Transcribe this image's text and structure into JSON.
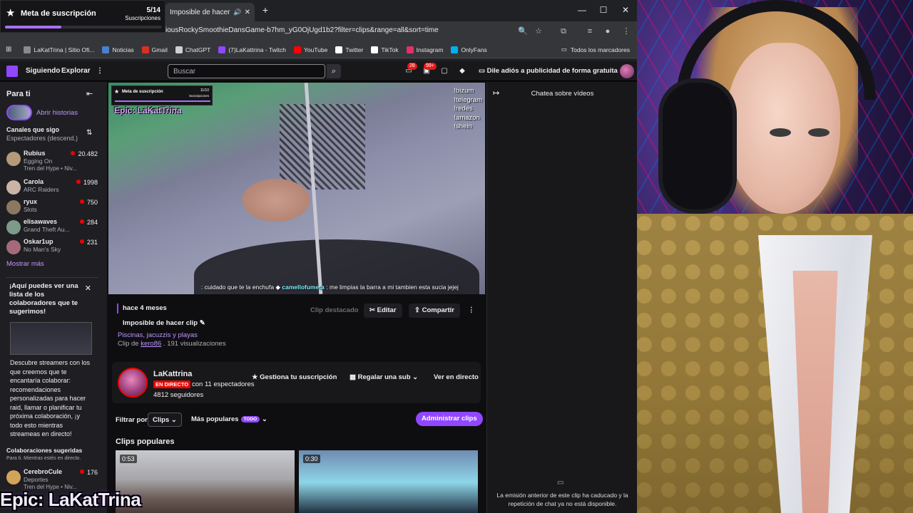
{
  "browser": {
    "tab_title": "Imposible de hacer cl",
    "url": "iousRockySmoothieDansGame-b7hm_yG0OjUgd1b2?filter=clips&range=all&sort=time",
    "bookmarks": [
      {
        "label": "LaKatTrina | Sitio Ofi...",
        "color": "#8a8a8a"
      },
      {
        "label": "Noticias",
        "color": "#4a7fd1"
      },
      {
        "label": "Gmail",
        "color": "#d93025"
      },
      {
        "label": "ChatGPT",
        "color": "#cfcfcf"
      },
      {
        "label": "(7)LaKattrina - Twitch",
        "color": "#9147ff"
      },
      {
        "label": "YouTube",
        "color": "#ff0000"
      },
      {
        "label": "Twitter",
        "color": "#ffffff"
      },
      {
        "label": "TikTok",
        "color": "#ffffff"
      },
      {
        "label": "Instagram",
        "color": "#e1306c"
      },
      {
        "label": "OnlyFans",
        "color": "#00aff0"
      }
    ],
    "all_bookmarks": "Todos los marcadores"
  },
  "sub_goal": {
    "title": "Meta de suscripción",
    "count": "5/14",
    "label": "Suscripciones",
    "progress": 0.357
  },
  "topnav": {
    "following": "Siguiendo",
    "explore": "Explorar",
    "search_placeholder": "Buscar",
    "notif_badge": "28",
    "inbox_badge": "99+",
    "ad_free": "Dile adiós a publicidad de forma gratuita"
  },
  "sidebar": {
    "heading": "Para ti",
    "stories": "Abrir historias",
    "followed_heading": "Canales que sigo",
    "followed_sort": "Espectadores (descend.)",
    "channels": [
      {
        "name": "Rubius",
        "game": "Egging On",
        "viewers": "20.482",
        "extra": "Tren del Hype • Niv...",
        "color": "#b49a7a"
      },
      {
        "name": "Carola",
        "game": "ARC Raiders",
        "viewers": "1998",
        "extra": "",
        "color": "#c9b4a6"
      },
      {
        "name": "ryux",
        "game": "Slots",
        "viewers": "750",
        "extra": "",
        "color": "#8c7860"
      },
      {
        "name": "elisawaves",
        "game": "Grand Theft Au...",
        "viewers": "284",
        "extra": "",
        "color": "#7d9a8a"
      },
      {
        "name": "Oskar1up",
        "game": "No Man's Sky",
        "viewers": "231",
        "extra": "",
        "color": "#a46a7a"
      }
    ],
    "show_more": "Mostrar más",
    "promo_heading": "¡Aquí puedes ver una lista de los colaboradores que te sugerimos!",
    "promo_text": "Descubre streamers con los que creemos que te encantaría colaborar: recomendaciones personalizadas para hacer raid, llamar o planificar tu próxima colaboración, ¡y todo esto mientras streameas en directo!",
    "suggested_heading": "Colaboraciones sugeridas",
    "suggested_sub": "Para ti. Mientras estés en directo.",
    "suggested_channel": {
      "name": "CerebroCule",
      "game": "Deportes",
      "viewers": "176",
      "extra": "Tren del Hype • Niv...",
      "color": "#d4a35a"
    }
  },
  "player": {
    "overlay_title": "Meta de suscripción",
    "overlay_count": "11/10",
    "overlay_label": "Suscripciones",
    "epic": "Epic: LaKatTrina",
    "commands": [
      "!bizum",
      "!telegram",
      "!redes",
      "!amazon",
      "!shein"
    ],
    "chat_prefix": ": cuidado que te la enchufa",
    "chat_user": "camellofumeta",
    "chat_text": ": me limpias la barra a mi tambien esta sucia jejej"
  },
  "clip": {
    "ago": "hace 4 meses",
    "featured": "Clip destacado",
    "edit": "Editar",
    "share": "Compartir",
    "title": "Imposible de hacer clip",
    "category": "Piscinas, jacuzzis y playas",
    "clip_by_prefix": "Clip de",
    "clip_by_user": "kero86",
    "views": " . 191 visualizaciones"
  },
  "channel": {
    "name": "LaKattrina",
    "live": "EN DIRECTO",
    "viewers": "con 11 espectadores",
    "followers": "4812 seguidores",
    "manage_sub": "Gestiona tu suscripción",
    "gift_sub": "Regalar una sub",
    "watch_live": "Ver en directo"
  },
  "clips_list": {
    "filter_label": "Filtrar por",
    "filter_value": "Clips",
    "sort_value": "Más populares",
    "sort_tag": "TODO",
    "admin": "Administrar clips",
    "heading": "Clips populares",
    "durations": [
      "0:53",
      "0:30"
    ]
  },
  "chat": {
    "title": "Chatea sobre vídeos",
    "message": "La emisión anterior de este clip ha caducado y la repetición de chat ya no está disponible."
  },
  "brand_overlay": "Epic: LaKatTrina"
}
